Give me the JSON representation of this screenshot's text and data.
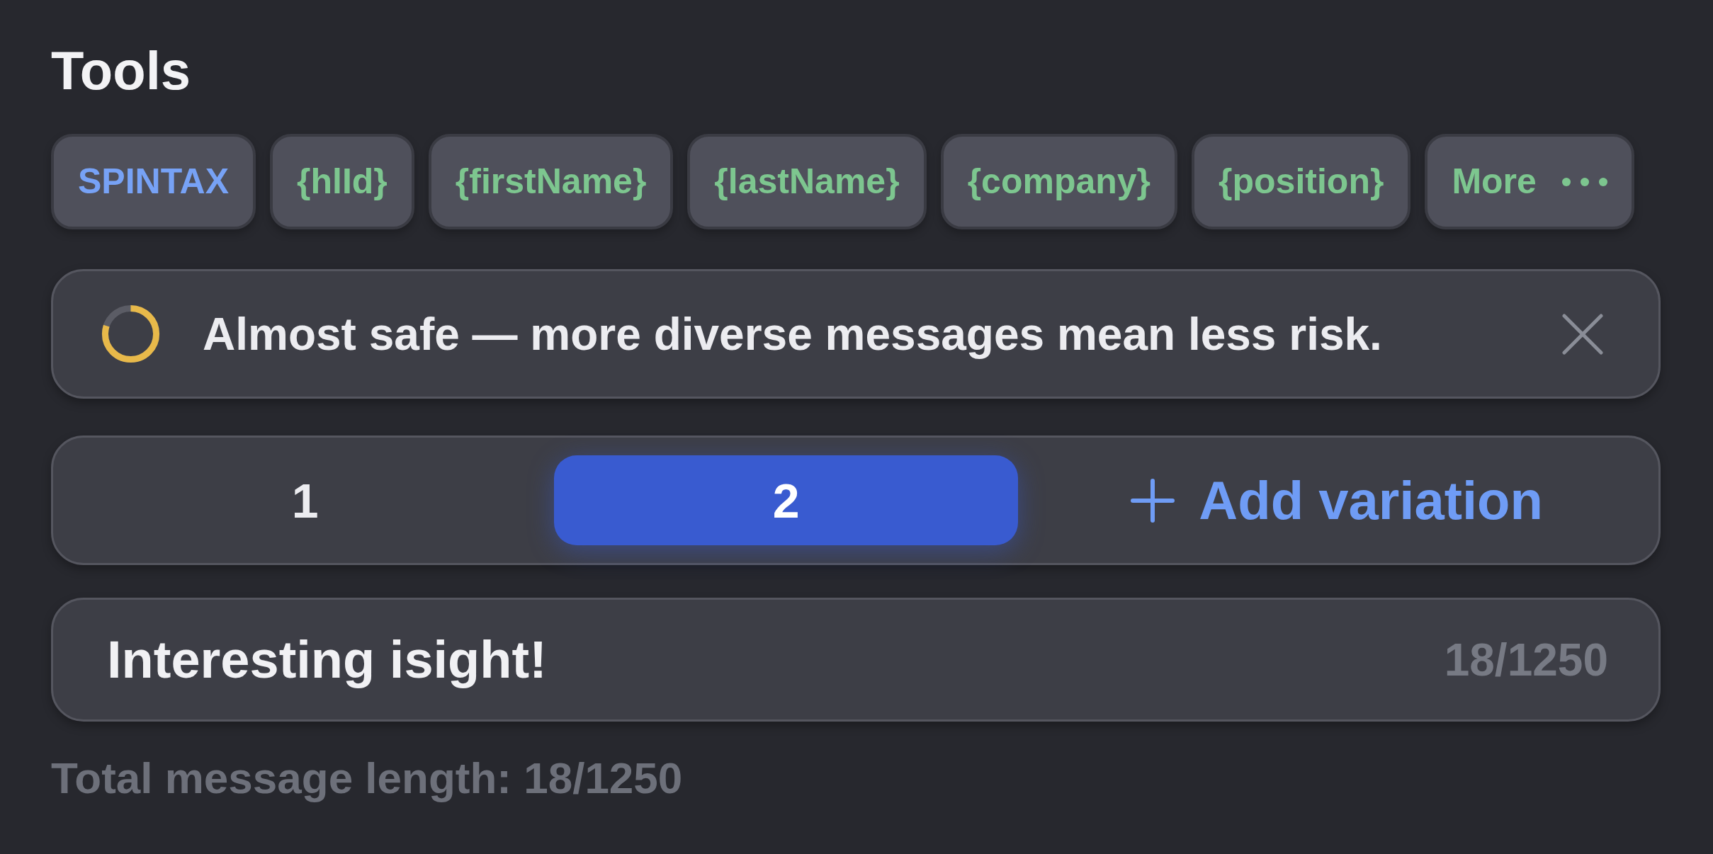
{
  "title": "Tools",
  "tools": [
    {
      "label": "SPINTAX",
      "kind": "spintax"
    },
    {
      "label": "{hlId}",
      "kind": "variable"
    },
    {
      "label": "{firstName}",
      "kind": "variable"
    },
    {
      "label": "{lastName}",
      "kind": "variable"
    },
    {
      "label": "{company}",
      "kind": "variable"
    },
    {
      "label": "{position}",
      "kind": "variable"
    },
    {
      "label": "More",
      "kind": "more"
    }
  ],
  "alert": {
    "message": "Almost safe — more diverse messages mean less risk.",
    "level": 0.8
  },
  "variations": [
    {
      "label": "1",
      "selected": false
    },
    {
      "label": "2",
      "selected": true
    }
  ],
  "add_variation": {
    "label": "Add variation"
  },
  "message_field": {
    "value": "Interesting isight!",
    "counter": "18/1250"
  },
  "total_length": "Total message length: 18/1250"
}
